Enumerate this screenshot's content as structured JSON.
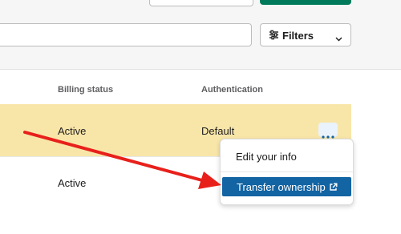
{
  "toolbar": {
    "filters_label": "Filters",
    "filters_icon": "sliders-icon"
  },
  "table": {
    "headers": {
      "billing_status": "Billing status",
      "authentication": "Authentication"
    },
    "rows": [
      {
        "billing_status": "Active",
        "authentication": "Default",
        "highlighted": true
      },
      {
        "billing_status": "Active",
        "authentication": ""
      }
    ]
  },
  "context_menu": {
    "items": [
      {
        "label": "Edit your info"
      },
      {
        "label": "Transfer ownership",
        "icon": "external-link-icon",
        "selected": true
      }
    ]
  },
  "colors": {
    "accent": "#1264a3",
    "row_highlight": "#f8e6a9",
    "primary_button": "#007a5a",
    "annotation_arrow": "#e8201b"
  }
}
